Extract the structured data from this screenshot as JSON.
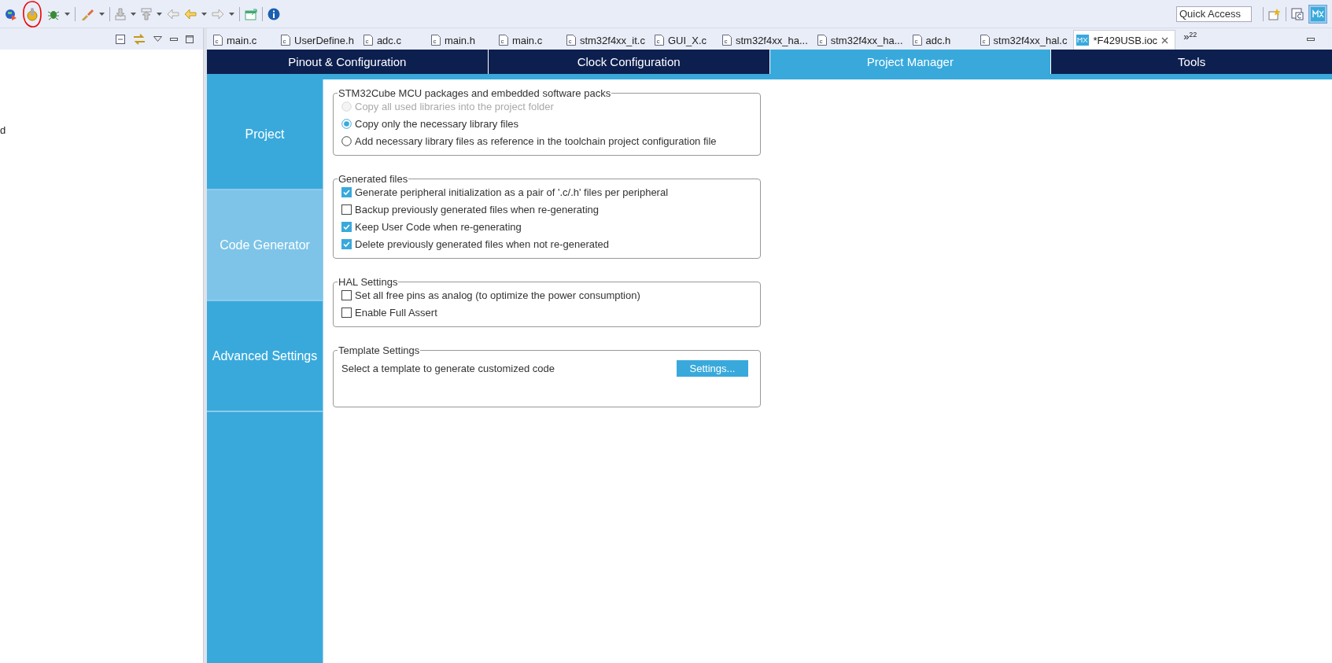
{
  "toolbar": {
    "quick_access": {
      "placeholder": "Quick Access"
    }
  },
  "left_panel": {
    "text": "d"
  },
  "editor_tabs": [
    {
      "label": "main.c",
      "kind": "c",
      "selected": false
    },
    {
      "label": "UserDefine.h",
      "kind": "c",
      "selected": false
    },
    {
      "label": "adc.c",
      "kind": "c",
      "selected": false
    },
    {
      "label": "main.h",
      "kind": "c",
      "selected": false
    },
    {
      "label": "main.c",
      "kind": "c",
      "selected": false
    },
    {
      "label": "stm32f4xx_it.c",
      "kind": "c",
      "selected": false
    },
    {
      "label": "GUI_X.c",
      "kind": "c",
      "selected": false
    },
    {
      "label": "stm32f4xx_ha...",
      "kind": "c",
      "selected": false
    },
    {
      "label": "stm32f4xx_ha...",
      "kind": "c",
      "selected": false
    },
    {
      "label": "adc.h",
      "kind": "c",
      "selected": false
    },
    {
      "label": "stm32f4xx_hal.c",
      "kind": "c",
      "selected": false
    },
    {
      "label": "*F429USB.ioc",
      "kind": "mx",
      "selected": true
    }
  ],
  "overflow_tabs": {
    "symbol": "»",
    "count": "22"
  },
  "perspective_tabs": [
    {
      "label": "Pinout & Configuration",
      "selected": false
    },
    {
      "label": "Clock Configuration",
      "selected": false
    },
    {
      "label": "Project Manager",
      "selected": true
    },
    {
      "label": "Tools",
      "selected": false
    }
  ],
  "side_nav": [
    {
      "label": "Project",
      "selected": false
    },
    {
      "label": "Code Generator",
      "selected": true
    },
    {
      "label": "Advanced Settings",
      "selected": false
    }
  ],
  "groups": [
    {
      "title": "STM32Cube MCU packages and embedded software packs",
      "options": [
        {
          "kind": "radio",
          "label": "Copy all used libraries into the project folder",
          "checked": false,
          "disabled": true
        },
        {
          "kind": "radio",
          "label": "Copy only the necessary library files",
          "checked": true,
          "disabled": false
        },
        {
          "kind": "radio",
          "label": "Add necessary library files as reference in the toolchain project configuration file",
          "checked": false,
          "disabled": false
        }
      ]
    },
    {
      "title": "Generated files",
      "options": [
        {
          "kind": "checkbox",
          "label": "Generate peripheral initialization as a pair of '.c/.h' files per peripheral",
          "checked": true,
          "disabled": false
        },
        {
          "kind": "checkbox",
          "label": "Backup previously generated files when re-generating",
          "checked": false,
          "disabled": false
        },
        {
          "kind": "checkbox",
          "label": "Keep User Code when re-generating",
          "checked": true,
          "disabled": false
        },
        {
          "kind": "checkbox",
          "label": "Delete previously generated files when not re-generated",
          "checked": true,
          "disabled": false
        }
      ]
    },
    {
      "title": "HAL Settings",
      "options": [
        {
          "kind": "checkbox",
          "label": "Set all free pins as analog (to optimize the power consumption)",
          "checked": false,
          "disabled": false
        },
        {
          "kind": "checkbox",
          "label": "Enable Full Assert",
          "checked": false,
          "disabled": false
        }
      ]
    },
    {
      "title": "Template Settings",
      "text": "Select a template to generate customized code",
      "button": "Settings..."
    }
  ]
}
